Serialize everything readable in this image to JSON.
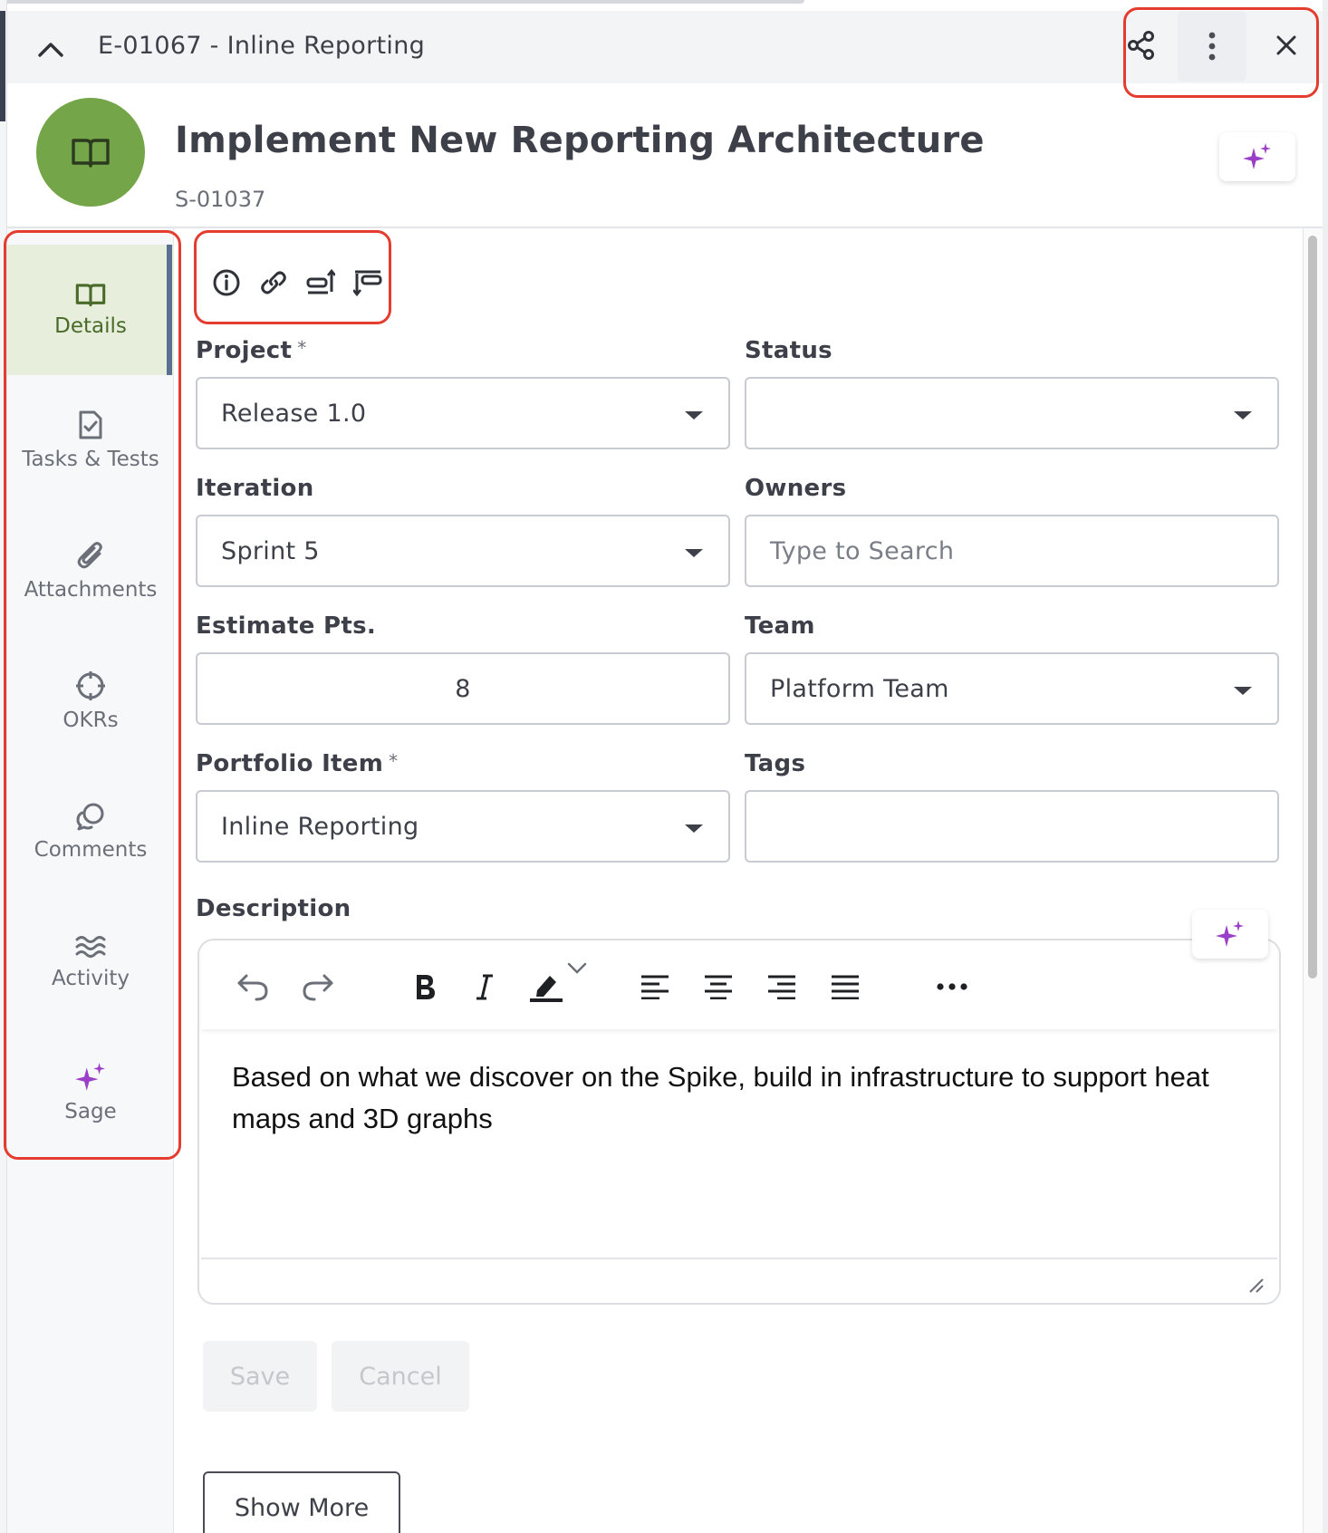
{
  "header": {
    "breadcrumb": "E-01067 - Inline Reporting",
    "share_icon": "share-icon",
    "more_icon": "more-vertical-icon",
    "close_icon": "close-icon"
  },
  "item": {
    "title": "Implement New Reporting Architecture",
    "id": "S-01037",
    "avatar_icon": "book-open-icon",
    "avatar_color": "#74a548"
  },
  "sidebar": {
    "items": [
      {
        "label": "Details",
        "icon": "book-open-icon",
        "active": true
      },
      {
        "label": "Tasks & Tests",
        "icon": "file-check-icon"
      },
      {
        "label": "Attachments",
        "icon": "paperclip-icon"
      },
      {
        "label": "OKRs",
        "icon": "target-icon"
      },
      {
        "label": "Comments",
        "icon": "chat-bubbles-icon"
      },
      {
        "label": "Activity",
        "icon": "waves-icon"
      },
      {
        "label": "Sage",
        "icon": "sparkles-icon"
      }
    ]
  },
  "toolbar_icons": [
    "info-icon",
    "link-icon",
    "upstream-icon",
    "downstream-icon"
  ],
  "form": {
    "project": {
      "label": "Project",
      "required": "*",
      "value": "Release 1.0"
    },
    "status": {
      "label": "Status",
      "value": ""
    },
    "iteration": {
      "label": "Iteration",
      "value": "Sprint 5"
    },
    "owners": {
      "label": "Owners",
      "placeholder": "Type to Search"
    },
    "estimate": {
      "label": "Estimate Pts.",
      "value": "8"
    },
    "team": {
      "label": "Team",
      "value": "Platform Team"
    },
    "portfolio": {
      "label": "Portfolio Item",
      "required": "*",
      "value": "Inline Reporting"
    },
    "tags": {
      "label": "Tags",
      "value": ""
    },
    "description": {
      "label": "Description",
      "text": "Based on what we discover on the Spike, build in infrastructure to support heat maps and 3D graphs"
    }
  },
  "editor_toolbar": [
    "undo-icon",
    "redo-icon",
    "bold-icon",
    "italic-icon",
    "highlight-icon",
    "align-left-icon",
    "align-center-icon",
    "align-right-icon",
    "justify-icon",
    "more-horizontal-icon"
  ],
  "buttons": {
    "save": "Save",
    "cancel": "Cancel",
    "show_more": "Show More"
  },
  "colors": {
    "accent_sage": "#9b3ec8",
    "highlight_box": "#e43c2f",
    "active_nav_bg": "#e7efdc"
  }
}
